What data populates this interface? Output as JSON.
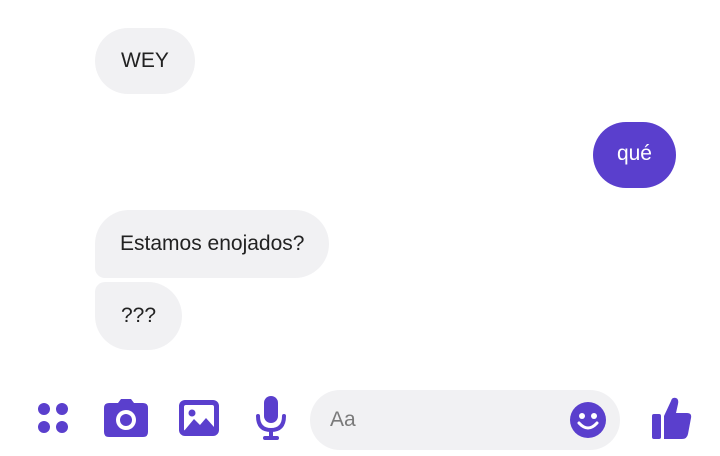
{
  "conversation": {
    "messages": [
      {
        "sender": "other",
        "text": "WEY"
      },
      {
        "sender": "me",
        "text": "qué"
      },
      {
        "sender": "other",
        "text": "Estamos enojados?"
      },
      {
        "sender": "other",
        "text": "???"
      }
    ]
  },
  "composer": {
    "placeholder": "Aa",
    "icons": [
      "menu-dots-icon",
      "camera-icon",
      "gallery-icon",
      "microphone-icon",
      "emoji-icon",
      "thumbs-up-icon"
    ]
  },
  "colors": {
    "accent": "#5a3fcd",
    "incoming_bubble": "#f1f1f3",
    "background": "#ffffff"
  }
}
